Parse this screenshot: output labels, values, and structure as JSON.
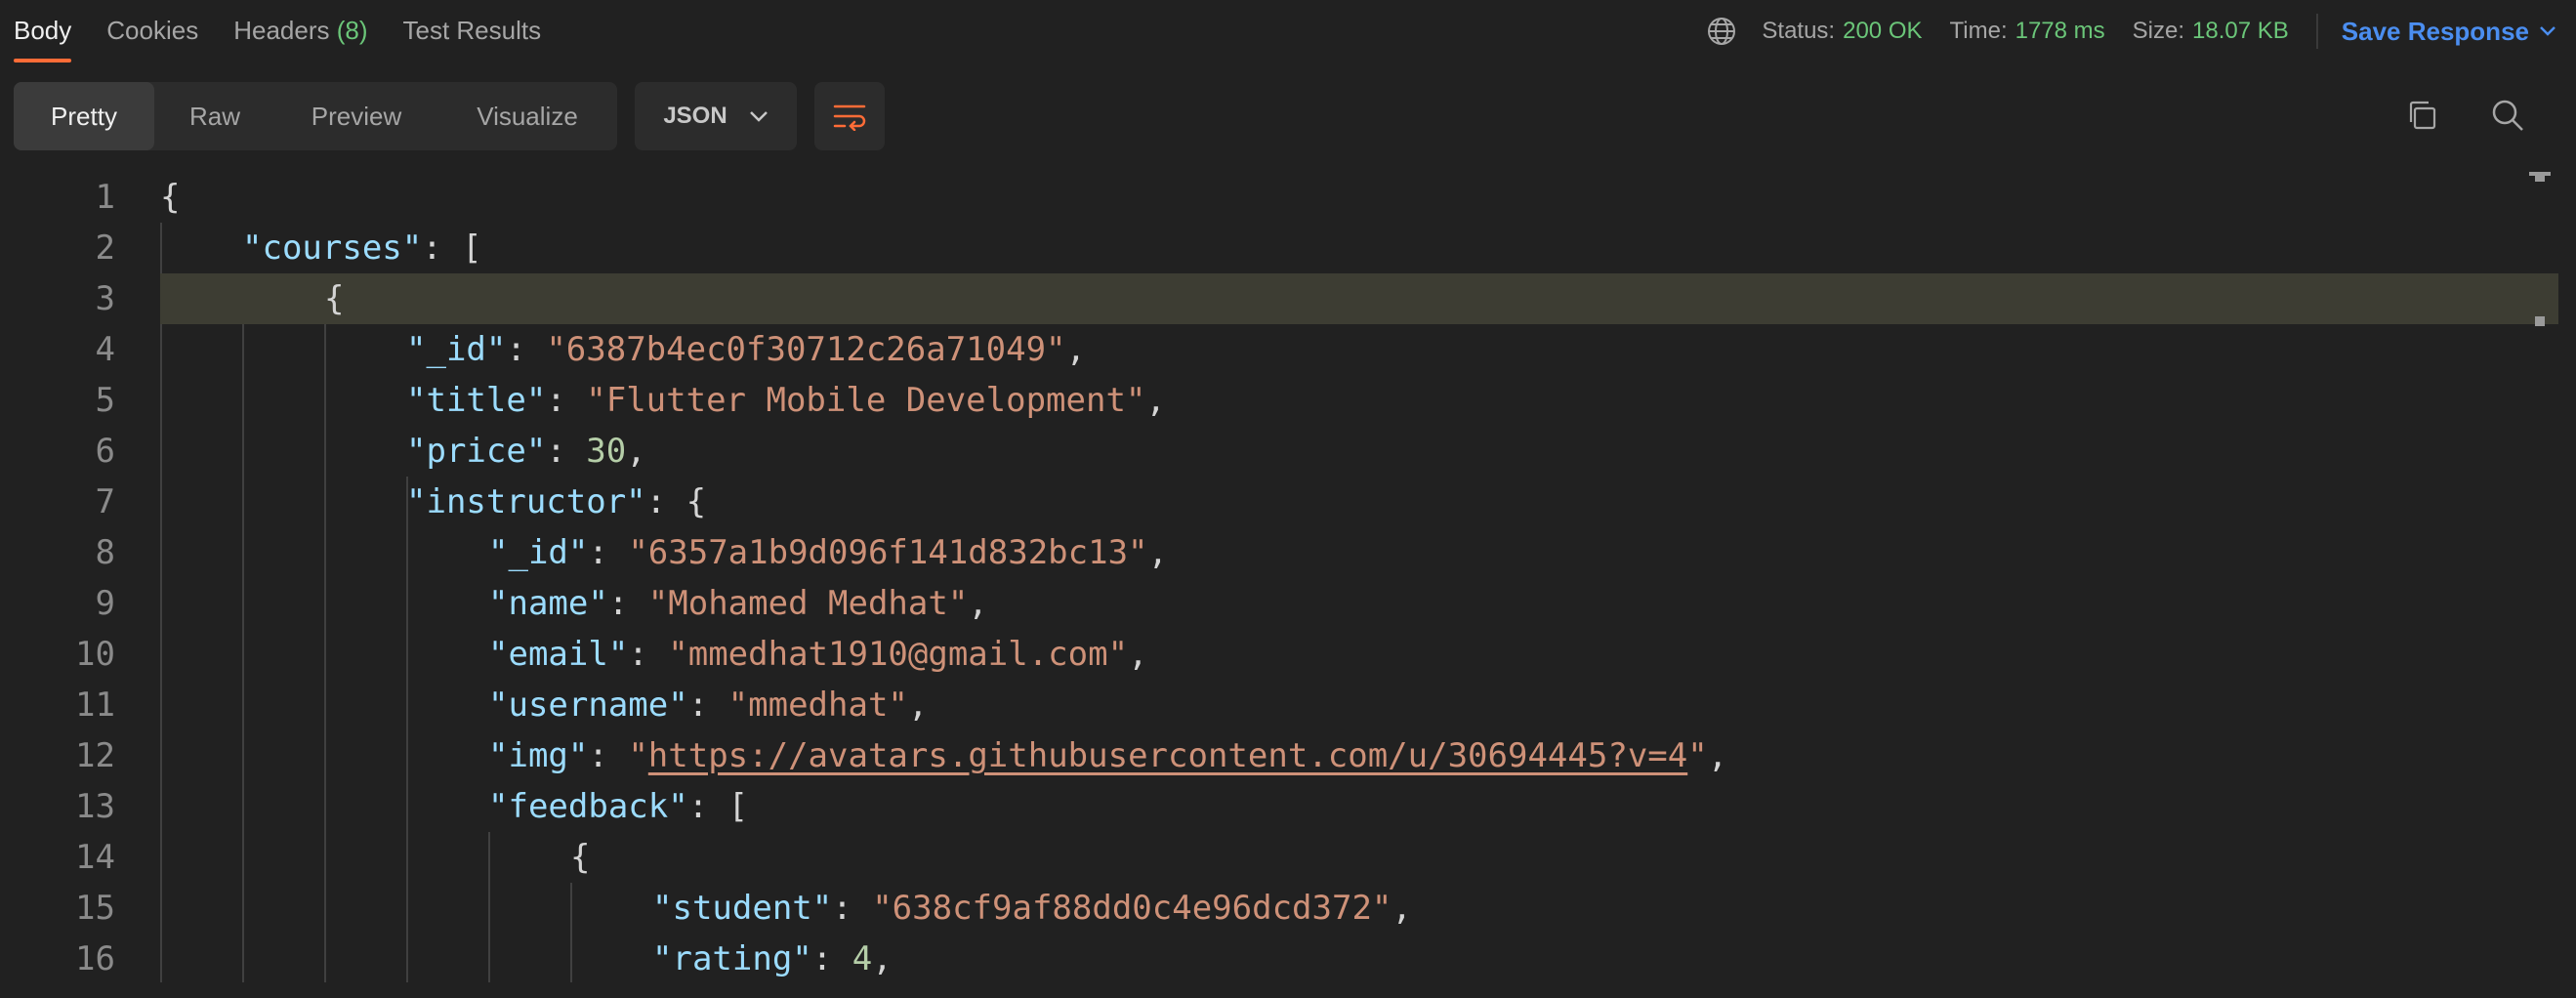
{
  "tabs": [
    {
      "label": "Body"
    },
    {
      "label": "Cookies"
    },
    {
      "label": "Headers",
      "count": "(8)"
    },
    {
      "label": "Test Results"
    }
  ],
  "status": {
    "status_label": "Status:",
    "status_value": "200 OK",
    "time_label": "Time:",
    "time_value": "1778 ms",
    "size_label": "Size:",
    "size_value": "18.07 KB",
    "save_label": "Save Response",
    "accent_color": "#6bc679",
    "link_color": "#4b8ef0"
  },
  "toolbar": {
    "views": [
      "Pretty",
      "Raw",
      "Preview",
      "Visualize"
    ],
    "active_view": "Pretty",
    "format": "JSON",
    "icons": [
      "wrap-lines-icon",
      "copy-icon",
      "search-icon"
    ]
  },
  "editor": {
    "highlighted_line": 3,
    "lines": [
      {
        "n": "1"
      },
      {
        "n": "2"
      },
      {
        "n": "3"
      },
      {
        "n": "4"
      },
      {
        "n": "5"
      },
      {
        "n": "6"
      },
      {
        "n": "7"
      },
      {
        "n": "8"
      },
      {
        "n": "9"
      },
      {
        "n": "10"
      },
      {
        "n": "11"
      },
      {
        "n": "12"
      },
      {
        "n": "13"
      },
      {
        "n": "14"
      },
      {
        "n": "15"
      },
      {
        "n": "16"
      }
    ],
    "tokens": {
      "l1_open": "{",
      "l2_key": "\"courses\"",
      "l2_rest": ": [",
      "l3_open": "{",
      "l4_key": "\"_id\"",
      "l4_val": "\"6387b4ec0f30712c26a71049\"",
      "l5_key": "\"title\"",
      "l5_val": "\"Flutter Mobile Development\"",
      "l6_key": "\"price\"",
      "l6_val": "30",
      "l7_key": "\"instructor\"",
      "l7_rest": ": {",
      "l8_key": "\"_id\"",
      "l8_val": "\"6357a1b9d096f141d832bc13\"",
      "l9_key": "\"name\"",
      "l9_val": "\"Mohamed Medhat\"",
      "l10_key": "\"email\"",
      "l10_val": "\"mmedhat1910@gmail.com\"",
      "l11_key": "\"username\"",
      "l11_val": "\"mmedhat\"",
      "l12_key": "\"img\"",
      "l12_url": "https://avatars.githubusercontent.com/u/30694445?v=4",
      "l13_key": "\"feedback\"",
      "l13_rest": ": [",
      "l14_open": "{",
      "l15_key": "\"student\"",
      "l15_val": "\"638cf9af88dd0c4e96dcd372\"",
      "l16_key": "\"rating\"",
      "l16_val": "4",
      "colon": ": ",
      "comma": ",",
      "quote": "\""
    }
  }
}
